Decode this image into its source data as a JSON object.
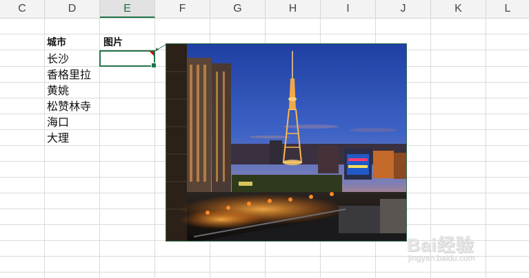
{
  "columns": [
    "C",
    "D",
    "E",
    "F",
    "G",
    "H",
    "I",
    "J",
    "K",
    "L"
  ],
  "active_column": "E",
  "headers": {
    "city": "城市",
    "picture": "图片"
  },
  "cities": [
    "长沙",
    "香格里拉",
    "黄姚",
    "松赞林寺",
    "海口",
    "大理"
  ],
  "selected_cell": "E3",
  "picture": {
    "subject": "city-night-skyline-tv-tower"
  },
  "watermark": {
    "brand": "Bai经验",
    "url": "jingyan.baidu.com"
  },
  "colors": {
    "grid": "#dadada",
    "header_bg": "#f3f3f3",
    "selection": "#217346",
    "comment_marker": "#d40000"
  }
}
